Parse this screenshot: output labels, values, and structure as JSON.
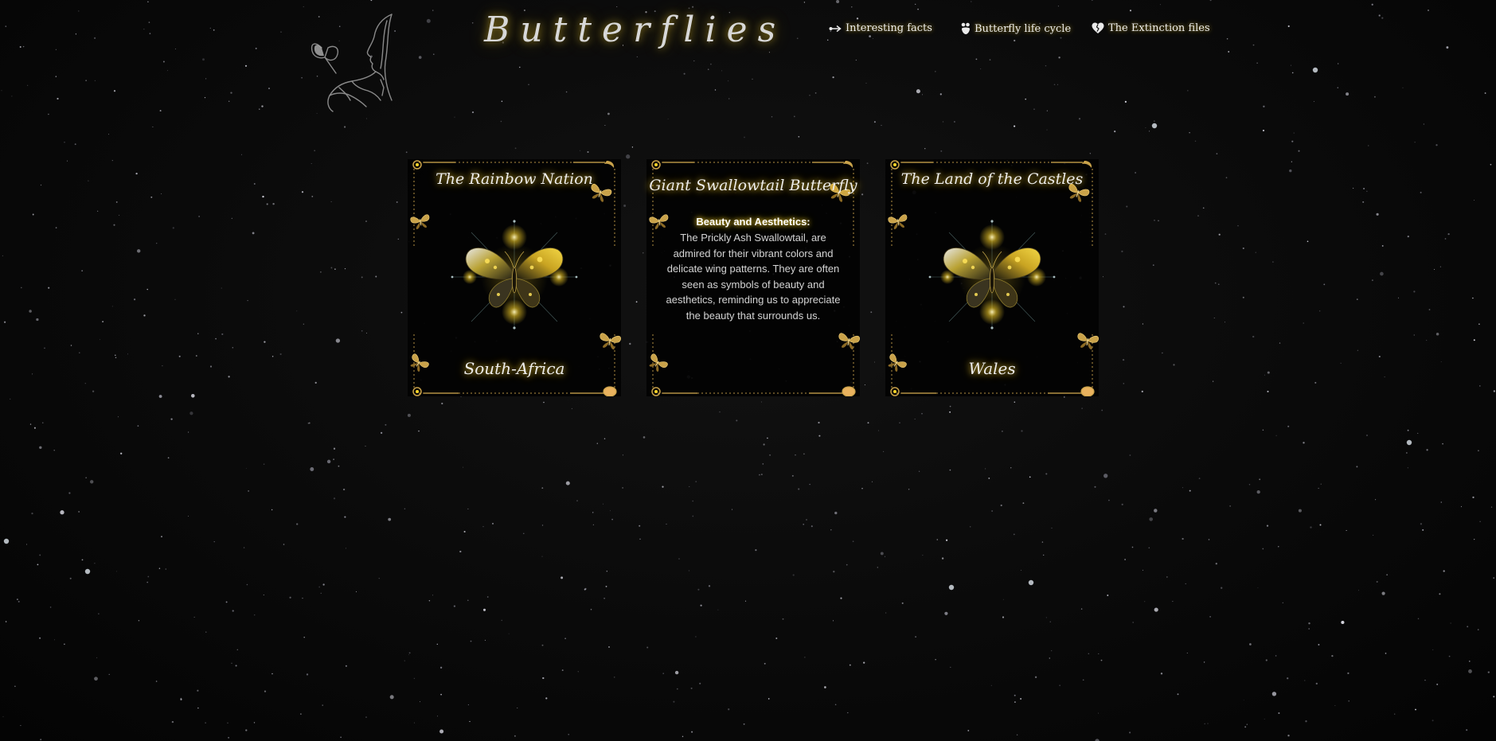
{
  "header": {
    "title": "Butterflies",
    "nav": [
      {
        "label": "Interesting facts",
        "icon": "arrow-right-icon"
      },
      {
        "label": "Butterfly life cycle",
        "icon": "life-cycle-icon"
      },
      {
        "label": "The Extinction files",
        "icon": "broken-heart-icon"
      }
    ]
  },
  "cards": [
    {
      "title": "The Rainbow Nation",
      "caption": "South-Africa"
    },
    {
      "title": "Giant Swallowtail Butterfly",
      "fact_heading": "Beauty and Aesthetics:",
      "fact_body": "The Prickly Ash Swallowtail, are admired for their vibrant colors and delicate wing patterns. They are often seen as symbols of beauty and aesthetics, reminding us to appreciate the beauty that surrounds us."
    },
    {
      "title": "The Land of the Castles",
      "caption": "Wales"
    }
  ],
  "colors": {
    "background": "#050505",
    "text": "#ececec",
    "glow": "#ffd628",
    "gold": "#c9a24a"
  }
}
